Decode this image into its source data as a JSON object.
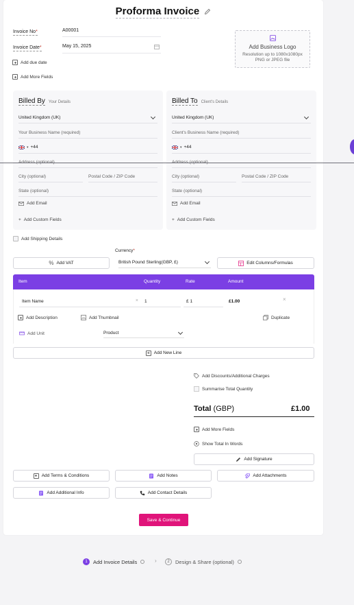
{
  "title": "Proforma Invoice",
  "invoice": {
    "number_label": "Invoice No",
    "number_value": "A00001",
    "date_label": "Invoice Date",
    "date_value": "May 15, 2025",
    "required_mark": "*",
    "add_due_date": "Add due date",
    "add_more_fields": "Add More Fields"
  },
  "logo": {
    "title": "Add Business Logo",
    "line1": "Resolution up to 1080x1080px",
    "line2": "PNG or JPEG file"
  },
  "billed_by": {
    "heading": "Billed By",
    "sub": "Your Details",
    "country": "United Kingdom (UK)",
    "business_name": "Your Business Name (required)",
    "phone_code": "+44",
    "address": "Address (optional)",
    "city": "City (optional)",
    "postal": "Postal Code / ZIP Code",
    "state": "State (optional)",
    "add_email": "Add Email",
    "add_custom": "Add Custom Fields"
  },
  "billed_to": {
    "heading": "Billed To",
    "sub": "Client's Details",
    "country": "United Kingdom (UK)",
    "business_name": "Client's Business Name (required)",
    "phone_code": "+44",
    "address": "Address (optional)",
    "city": "City (optional)",
    "postal": "Postal Code / ZIP Code",
    "state": "State (optional)",
    "add_email": "Add Email",
    "add_custom": "Add Custom Fields"
  },
  "shipping": "Add Shipping Details",
  "currency": {
    "label": "Currency",
    "required_mark": "*",
    "value": "British Pound Sterling(GBP, £)"
  },
  "actions": {
    "add_vat": "Add VAT",
    "edit_columns": "Edit Columns/Formulas"
  },
  "table": {
    "headers": {
      "item": "Item",
      "quantity": "Quantity",
      "rate": "Rate",
      "amount": "Amount"
    },
    "row": {
      "item_name": "Item Name",
      "quantity": "1",
      "currency_symbol": "£",
      "rate": "1",
      "amount": "£1.00",
      "add_description": "Add Description",
      "add_thumbnail": "Add Thumbnail",
      "duplicate": "Duplicate",
      "add_unit": "Add Unit",
      "product": "Product"
    },
    "add_new_line": "Add New Line"
  },
  "summary": {
    "discounts": "Add Discounts/Additional Charges",
    "summarise": "Summarise Total Quantity",
    "total_label": "Total",
    "total_currency": "(GBP)",
    "total_value": "£1.00",
    "add_more_fields": "Add More Fields",
    "show_words": "Show Total In Words",
    "add_signature": "Add Signature"
  },
  "extras": {
    "terms": "Add Terms & Conditions",
    "notes": "Add Notes",
    "attachments": "Add Attachments",
    "additional_info": "Add Additional Info",
    "contact": "Add Contact Details"
  },
  "save": "Save & Continue",
  "steps": [
    {
      "num": "1",
      "label": "Add Invoice Details"
    },
    {
      "num": "2",
      "label": "Design & Share (optional)"
    }
  ],
  "colors": {
    "accent": "#7b3fe4",
    "save": "#e0147a"
  }
}
